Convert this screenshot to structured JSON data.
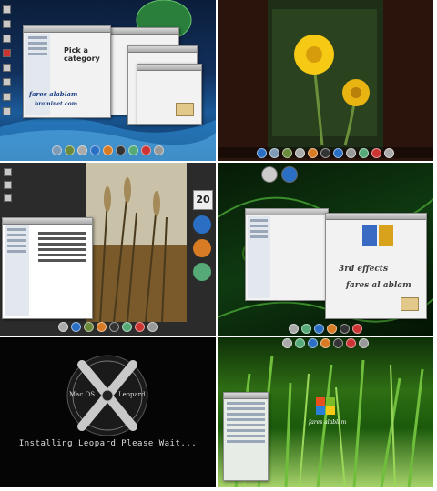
{
  "panel1": {
    "window_heading": "Pick a category",
    "credit": "fares alablam",
    "site": "braminet.com"
  },
  "panel3": {
    "clock_day": "20"
  },
  "panel4": {
    "effects_text": "3rd effects",
    "credit": "fares al ablam"
  },
  "panel5": {
    "logo_left": "Mac OS",
    "logo_right": "Leopard",
    "logo_letter": "X",
    "status": "Installing Leopard Please Wait..."
  },
  "panel6": {
    "credit": "fares alablam"
  },
  "colors": {
    "leaf_green": "#2f6e14",
    "flower_yellow": "#f6c915",
    "dock_blue": "#2a6fc4"
  }
}
